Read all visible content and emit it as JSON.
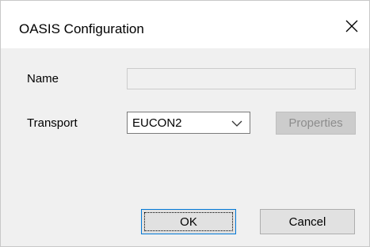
{
  "window": {
    "title": "OASIS Configuration",
    "close_icon": "close-icon"
  },
  "form": {
    "name_label": "Name",
    "name_value": "",
    "transport_label": "Transport",
    "transport_selected": "EUCON2",
    "transport_arrow_icon": "chevron-down-icon",
    "properties_label": "Properties"
  },
  "footer": {
    "ok_label": "OK",
    "cancel_label": "Cancel"
  },
  "colors": {
    "dialog_bg": "#f0f0f0",
    "titlebar_bg": "#ffffff",
    "ok_border": "#0078d7",
    "disabled_text": "#8d8d8d"
  }
}
